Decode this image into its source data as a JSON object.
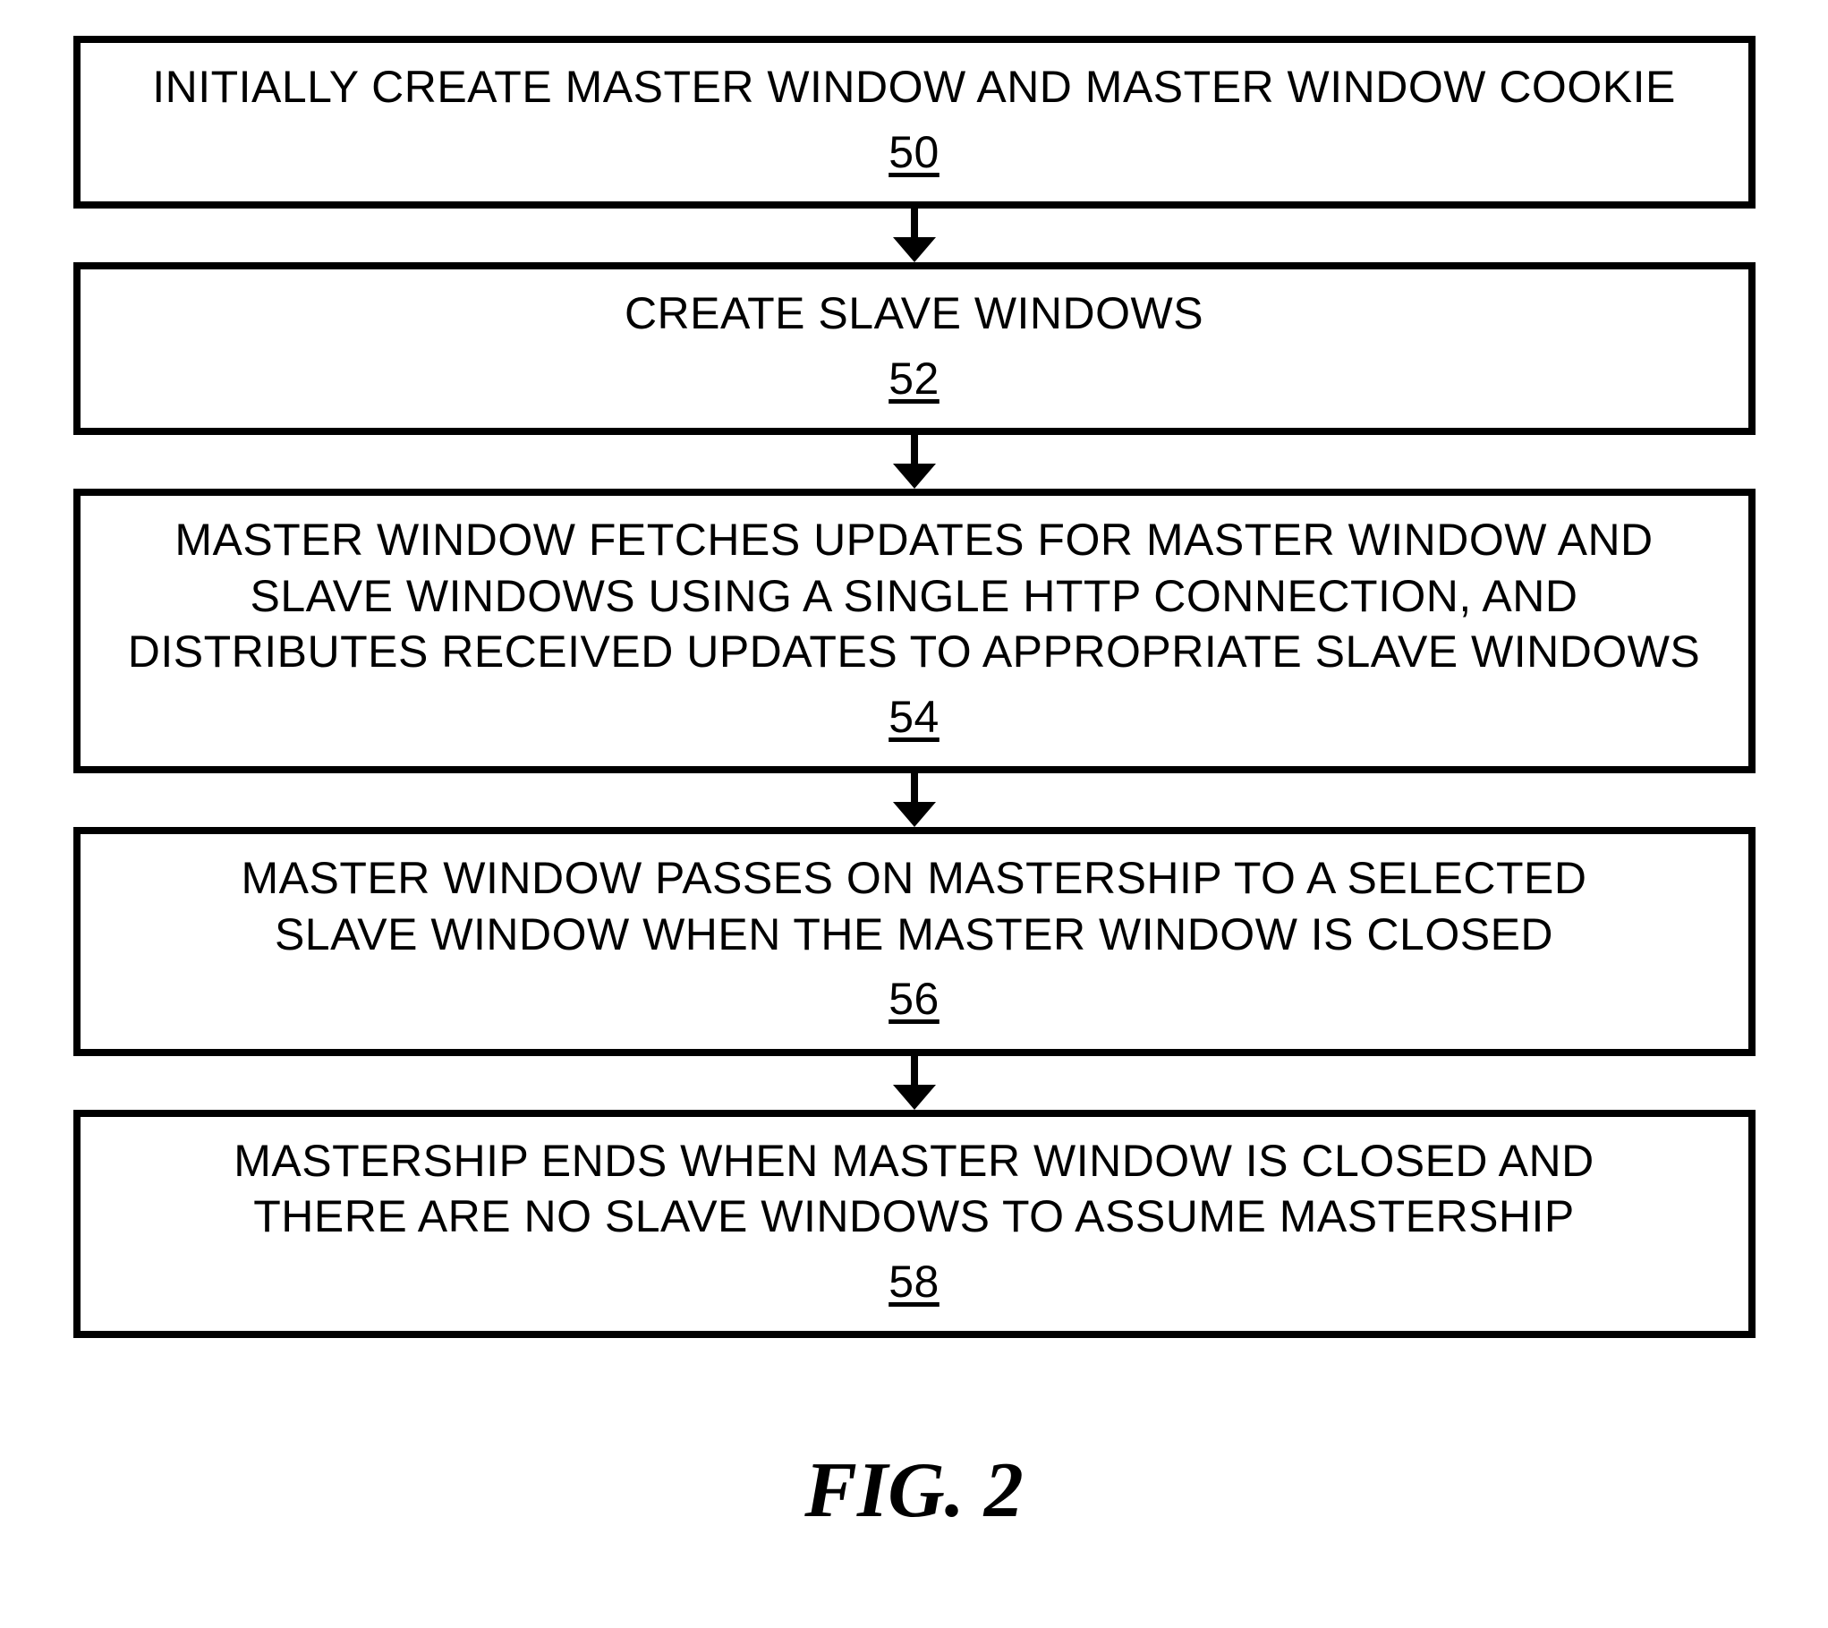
{
  "steps": [
    {
      "text": "INITIALLY CREATE MASTER WINDOW AND MASTER WINDOW COOKIE",
      "ref": "50"
    },
    {
      "text": "CREATE SLAVE WINDOWS",
      "ref": "52"
    },
    {
      "text": "MASTER WINDOW FETCHES UPDATES FOR MASTER WINDOW AND\nSLAVE WINDOWS USING A SINGLE HTTP CONNECTION, AND\nDISTRIBUTES RECEIVED UPDATES TO APPROPRIATE SLAVE WINDOWS",
      "ref": "54"
    },
    {
      "text": "MASTER WINDOW PASSES ON MASTERSHIP TO A SELECTED\nSLAVE WINDOW WHEN THE MASTER WINDOW IS CLOSED",
      "ref": "56"
    },
    {
      "text": "MASTERSHIP ENDS WHEN MASTER WINDOW IS CLOSED AND\nTHERE ARE NO SLAVE WINDOWS TO ASSUME MASTERSHIP",
      "ref": "58"
    }
  ],
  "figure_label": "FIG. 2"
}
